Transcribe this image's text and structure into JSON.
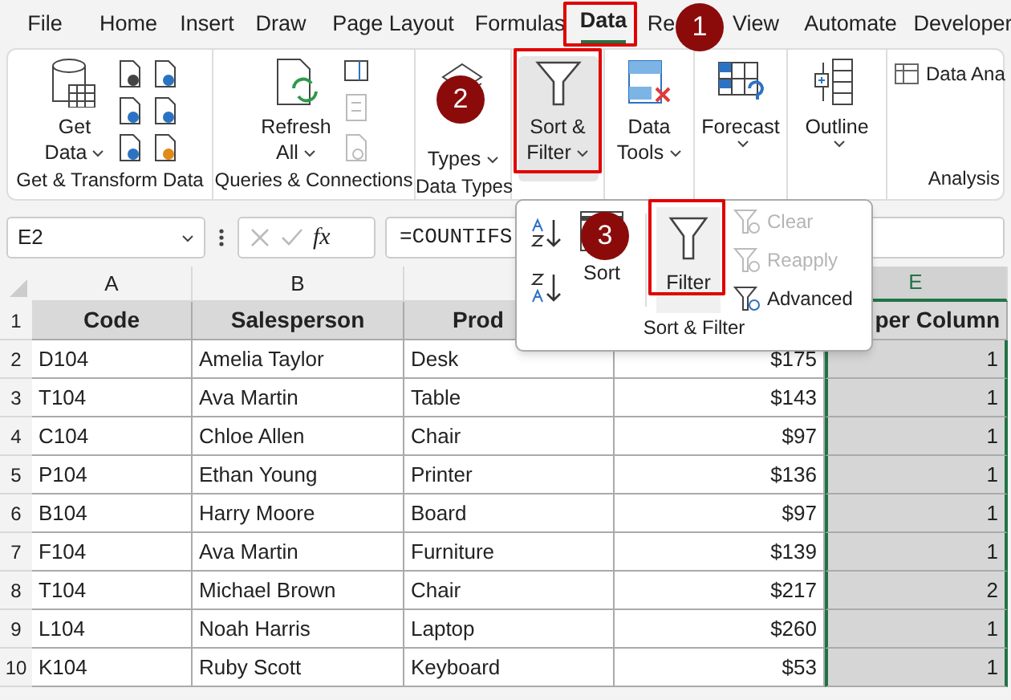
{
  "menu_tabs": [
    {
      "label": "File",
      "selected": false
    },
    {
      "label": "Home",
      "selected": false
    },
    {
      "label": "Insert",
      "selected": false
    },
    {
      "label": "Draw",
      "selected": false
    },
    {
      "label": "Page Layout",
      "selected": false
    },
    {
      "label": "Formulas",
      "selected": false
    },
    {
      "label": "Data",
      "selected": true
    },
    {
      "label": "Re",
      "selected": false
    },
    {
      "label": "View",
      "selected": false
    },
    {
      "label": "Automate",
      "selected": false
    },
    {
      "label": "Developer",
      "selected": false
    }
  ],
  "ribbon_groups": [
    {
      "label": "Get & Transform Data",
      "buttons": [
        {
          "kind": "get-data",
          "lines": [
            "Get",
            "Data"
          ]
        }
      ]
    },
    {
      "label": "Queries & Connections",
      "buttons": [
        {
          "kind": "refresh",
          "lines": [
            "Refresh",
            "All"
          ]
        }
      ]
    },
    {
      "label": "Data Types",
      "buttons": [
        {
          "kind": "data-types",
          "lines": [
            "Types"
          ]
        }
      ]
    },
    {
      "buttons": [
        {
          "kind": "sort-filter",
          "lines": [
            "Sort &",
            "Filter"
          ]
        }
      ]
    },
    {
      "buttons": [
        {
          "kind": "data-tools",
          "lines": [
            "Data",
            "Tools"
          ]
        }
      ]
    },
    {
      "buttons": [
        {
          "kind": "forecast",
          "lines": [
            "Forecast"
          ]
        }
      ]
    },
    {
      "buttons": [
        {
          "kind": "outline",
          "lines": [
            "Outline"
          ]
        }
      ]
    },
    {
      "label": "Analysis",
      "buttons": [
        {
          "kind": "analysis",
          "lines": [
            "Data Ana"
          ]
        }
      ]
    }
  ],
  "badges": [
    "1",
    "2",
    "3"
  ],
  "sort_filter_menu": {
    "sort_label": "Sort",
    "filter": {
      "label": "Filter",
      "selected": true
    },
    "small_items": [
      {
        "label": "Clear",
        "disabled": true
      },
      {
        "label": "Reapply",
        "disabled": true
      },
      {
        "label": "Advanced",
        "disabled": false
      }
    ],
    "group_label": "Sort & Filter"
  },
  "formula_bar": {
    "name_box": "E2",
    "fx": "fx",
    "formula": "=COUNTIFS"
  },
  "columns": [
    {
      "letter": "A",
      "selected": false
    },
    {
      "letter": "B",
      "selected": false
    },
    {},
    {},
    {
      "letter": "E",
      "selected": true
    }
  ],
  "header_row": {
    "number": "1",
    "cells": [
      "Code",
      "Salesperson",
      "Prod",
      "",
      "per Column"
    ]
  },
  "rows": [
    {
      "number": "2",
      "cells": [
        "D104",
        "Amelia Taylor",
        "Desk",
        "$175",
        "1"
      ]
    },
    {
      "number": "3",
      "cells": [
        "T104",
        "Ava Martin",
        "Table",
        "$143",
        "1"
      ]
    },
    {
      "number": "4",
      "cells": [
        "C104",
        "Chloe Allen",
        "Chair",
        "$97",
        "1"
      ]
    },
    {
      "number": "5",
      "cells": [
        "P104",
        "Ethan Young",
        "Printer",
        "$136",
        "1"
      ]
    },
    {
      "number": "6",
      "cells": [
        "B104",
        "Harry Moore",
        "Board",
        "$97",
        "1"
      ]
    },
    {
      "number": "7",
      "cells": [
        "F104",
        "Ava Martin",
        "Furniture",
        "$139",
        "1"
      ]
    },
    {
      "number": "8",
      "cells": [
        "T104",
        "Michael Brown",
        "Chair",
        "$217",
        "2"
      ]
    },
    {
      "number": "9",
      "cells": [
        "L104",
        "Noah Harris",
        "Laptop",
        "$260",
        "1"
      ]
    },
    {
      "number": "10",
      "cells": [
        "K104",
        "Ruby Scott",
        "Keyboard",
        "$53",
        "1"
      ]
    }
  ]
}
